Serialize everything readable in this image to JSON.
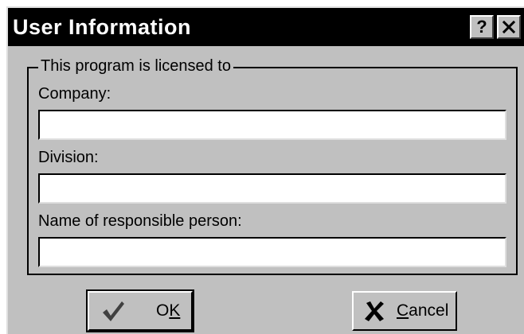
{
  "window": {
    "title": "User Information",
    "help_glyph": "?",
    "close_glyph": "✕"
  },
  "group": {
    "legend": "This program is licensed to",
    "fields": [
      {
        "label": "Company:",
        "value": ""
      },
      {
        "label": "Division:",
        "value": ""
      },
      {
        "label": "Name of responsible person:",
        "value": ""
      }
    ]
  },
  "buttons": {
    "ok": {
      "prefix": "O",
      "mnemonic": "K",
      "suffix": "",
      "icon": "checkmark-icon"
    },
    "cancel": {
      "prefix": "",
      "mnemonic": "C",
      "suffix": "ancel",
      "icon": "x-mark-icon"
    }
  },
  "colors": {
    "face": "#c0c0c0",
    "titlebar": "#000000",
    "title_text": "#ffffff",
    "input_bg": "#ffffff"
  }
}
